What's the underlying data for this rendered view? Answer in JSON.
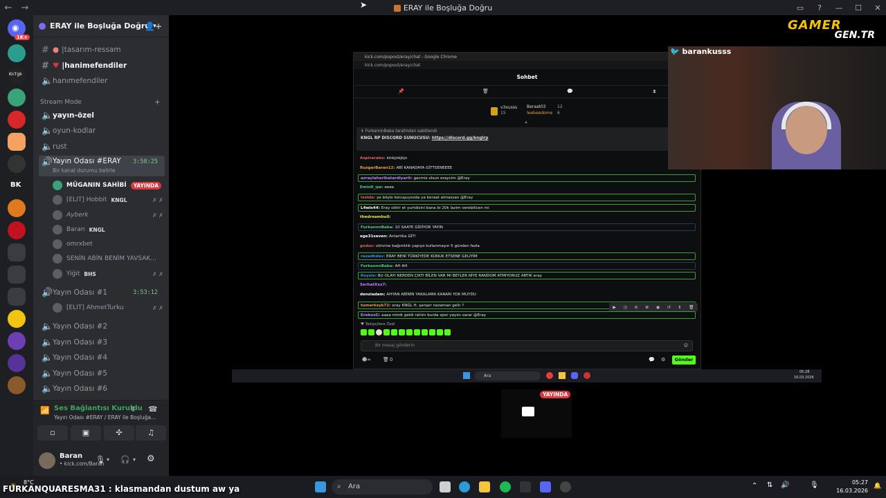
{
  "window": {
    "title": "ERAY ile Boşluğa Doğru"
  },
  "guilds": [
    {
      "badge": "1K+",
      "color": "#5865f2"
    },
    {
      "color": "#2a9d8f"
    },
    {
      "label": "KnTgk",
      "color": "#222"
    },
    {
      "color": "#3aa37a"
    },
    {
      "color": "#d62828"
    },
    {
      "color": "#f4a261"
    },
    {
      "color": "#333"
    },
    {
      "label": "BK",
      "color": "#1e1f22"
    },
    {
      "color": "#e07a1f"
    },
    {
      "color": "#c1121f"
    },
    {
      "color": "#555"
    },
    {
      "color": "#444"
    },
    {
      "color": "#f1c40f"
    },
    {
      "color": "#6c3fb5"
    },
    {
      "color": "#553399"
    },
    {
      "color": "#8b5a2b"
    }
  ],
  "server": {
    "name": "ERAY ile Boşluğa Doğru",
    "channels_top": [
      {
        "name": "tasarım-ressam"
      },
      {
        "name": "hanimefendiler"
      },
      {
        "name": "hanımefendiler"
      }
    ],
    "category": "Stream Mode",
    "text_channels": [
      "yayın-özel",
      "oyun-kodlar",
      "rust"
    ],
    "active_voice": {
      "name": "Yayın Odası #ERAY",
      "timer": "3:58:25",
      "status": "Bir kanal durumu belirle"
    },
    "voice_users": [
      {
        "name": "MÜGANIN SAHİBİ",
        "live": "YAYINDA"
      },
      {
        "name": "[ELIT] Hobbit",
        "tag": "KNGL"
      },
      {
        "name": "Ayberk"
      },
      {
        "name": "Baran",
        "tag": "KNGL"
      },
      {
        "name": "omrxbet"
      },
      {
        "name": "SENİN ABİN BENİM YAVSAK..."
      },
      {
        "name": "Yiğit",
        "tag": "BHS"
      }
    ],
    "voice2": {
      "name": "Yayın Odası #1",
      "timer": "3:53:12",
      "user": "[ELIT] AhmetTurku"
    },
    "other_voice": [
      "Yayın Odası #2",
      "Yayın Odası #3",
      "Yayın Odası #4",
      "Yayın Odası #5",
      "Yayın Odası #6"
    ]
  },
  "voice_panel": {
    "status": "Ses Bağlantısı Kuruldu",
    "location": "Yayın Odası #ERAY / ERAY ile Boşluğa..."
  },
  "user_panel": {
    "name": "Baran",
    "sub": "• kick.com/Baran"
  },
  "chat": {
    "window_title": "kick.com/popout/eray/chat - Google Chrome",
    "url": "kick.com/popout/eray/chat",
    "header": "Sohbet",
    "leaders": [
      {
        "name": "v3xusss",
        "value": "15"
      },
      {
        "name": "Beraat03",
        "value": "12"
      },
      {
        "name": "leebeedome",
        "value": "6"
      }
    ],
    "pinned_by": "FurkannnBaba tarafından sabitlendi",
    "pinned_text": "KNGL RP DISCORD SUNUCUSU:",
    "pinned_link": "https://discord.gg/knglrp",
    "messages": [
      {
        "user": "Aspirarabo:",
        "text": "kinkjnkjkjn",
        "color": "#e06060"
      },
      {
        "user": "RuzgarBaran12:",
        "text": "ABİ KANADAYA GİTTSENEEEE",
        "color": "#e8a040"
      },
      {
        "user": "azraylaherikatardiyarit:",
        "text": "gecmis olsun eraycim @Eray",
        "color": "#c080ff"
      },
      {
        "user": "Emin0_qw:",
        "text": "eeee",
        "color": "#50c878"
      },
      {
        "user": "Isolde:",
        "text": "ya böyle konuşuyozda ya beraat almassan @Eray",
        "color": "#e06060"
      },
      {
        "user": "L4wis44:",
        "text": "Eray siktir et yurtdisini bana bi 20k lazim verebilicen mi",
        "color": "#ffffff"
      },
      {
        "user": "thedreambull:",
        "text": "",
        "color": "#e8e840"
      },
      {
        "user": "FurkannnBaba:",
        "text": "10 SAATE GİDİYOR YAYIN",
        "color": "#50c878"
      },
      {
        "user": "ege31seven:",
        "text": "Antartika GİT!",
        "color": "#ffffff"
      },
      {
        "user": "goduc:",
        "text": "otrivine bağımlılık yapıyo kullanmayın 5 günden fazla",
        "color": "#e06060"
      },
      {
        "user": "rezadhdev:",
        "text": "ERAY BENİ TÜRKİYEDE KONUK ETSENE GELİYİM",
        "color": "#4090e0"
      },
      {
        "user": "FurkannnBaba:",
        "text": "AH AH",
        "color": "#50c878"
      },
      {
        "user": "Royzie:",
        "text": "BU OLAYI NERDEN ÇIKTI BİLEN VAR MI BEYLER NİYE RANDOM ATMIYORUZ ARTIK eray",
        "color": "#4090e0"
      },
      {
        "user": "SerhatXxx7:",
        "text": "",
        "color": "#c080ff"
      },
      {
        "user": "denziadam:",
        "text": "AHYAN ABİNİN YAKALAMA KARARI YOK MUYDU",
        "color": "#ffffff"
      },
      {
        "user": "tumerksyk72:",
        "text": "eray KNGL ft. şanşer nezaman gelir ?",
        "color": "#e8a040"
      },
      {
        "user": "ErebosG:",
        "text": "aaaa minik geldi rahim burda spor yayını sarar @Eray",
        "color": "#c080ff"
      }
    ],
    "followers_label": "Takipçilere Özel",
    "input_placeholder": "Bir mesaj gönderin",
    "send_label": "Gönder",
    "footer_count": "0"
  },
  "stream": {
    "cam_name": "barankusss",
    "logo_top": "GAMER",
    "logo_bottom": "GEN.TR",
    "live_badge": "YAYINDA",
    "inner_search": "Ara",
    "inner_time": "05:28",
    "inner_date": "16.03.2026"
  },
  "taskbar": {
    "ticker": "FURKANQUARESMA31 : klasmandan dustum aw ya",
    "weather": "8°C",
    "search": "Ara",
    "time": "05:27",
    "date": "16.03.2026"
  }
}
